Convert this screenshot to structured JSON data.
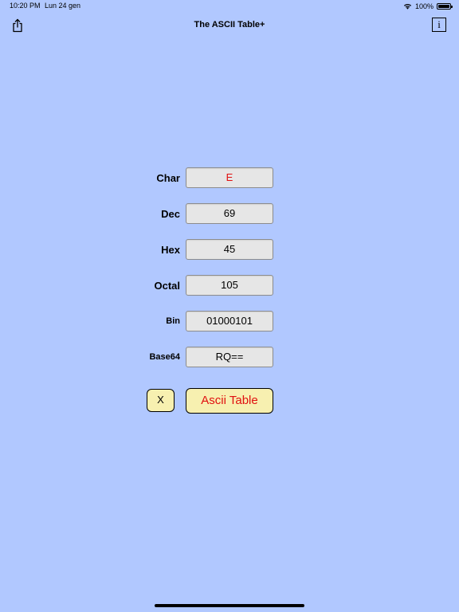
{
  "status_bar": {
    "time": "10:20 PM",
    "date": "Lun 24 gen",
    "battery": "100%",
    "icons": [
      "wifi-icon",
      "battery-icon"
    ]
  },
  "nav": {
    "title": "The ASCII Table+",
    "share_icon": "share-icon",
    "info_label": "i"
  },
  "fields": {
    "char": {
      "label": "Char",
      "value": "E"
    },
    "dec": {
      "label": "Dec",
      "value": "69"
    },
    "hex": {
      "label": "Hex",
      "value": "45"
    },
    "octal": {
      "label": "Octal",
      "value": "105"
    },
    "bin": {
      "label": "Bin",
      "value": "01000101"
    },
    "base64": {
      "label": "Base64",
      "value": "RQ=="
    }
  },
  "buttons": {
    "clear_label": "X",
    "ascii_table_label": "Ascii Table"
  },
  "colors": {
    "background": "#b1c8ff",
    "button_fill": "#f7f0b0",
    "accent_red": "#e01010",
    "field_fill": "#e6e6e6"
  }
}
